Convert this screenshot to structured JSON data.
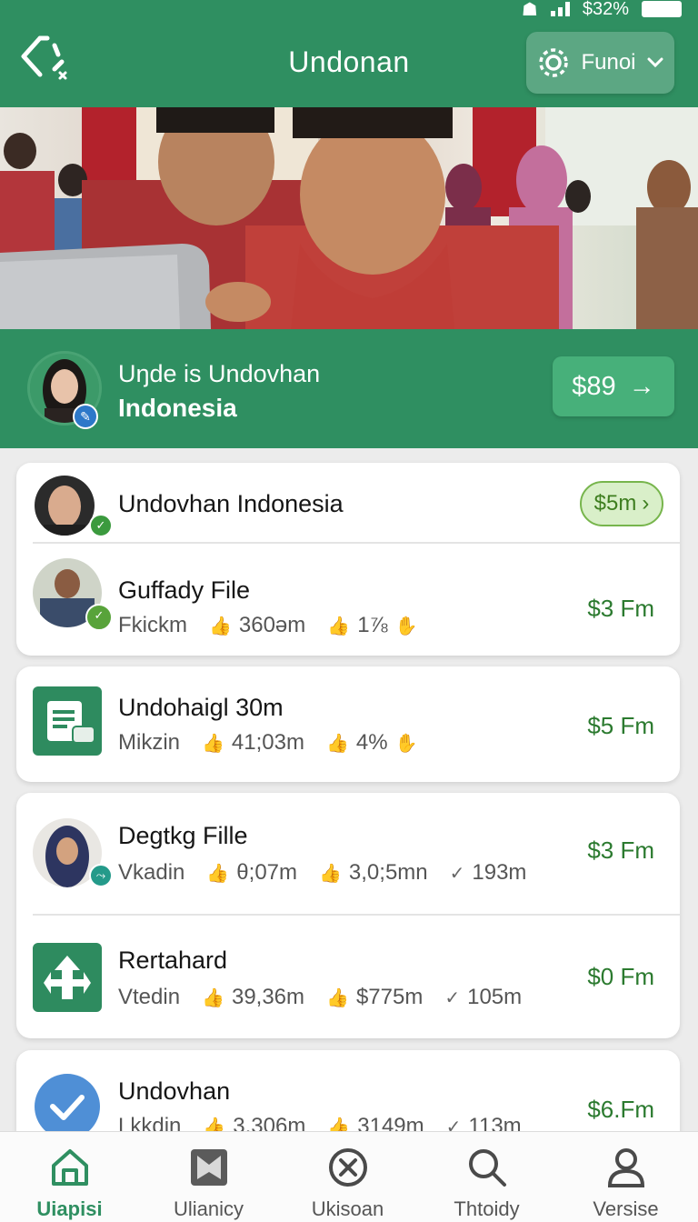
{
  "status_bar": {
    "battery": "$32%"
  },
  "header": {
    "title": "Undonan",
    "action_label": "Funoi",
    "logo_icon": "logo-icon",
    "brand_color": "#2f8f61"
  },
  "promo": {
    "line1": "Uŋde is Undovhan",
    "line2": "Indonesia",
    "price": "$89",
    "arrow": "→"
  },
  "cards": [
    {
      "rows": [
        {
          "title": "Undovhan Indonesia",
          "pill": "$5m",
          "pill_arrow": "›"
        },
        {
          "title": "Guffady File",
          "meta1": "Fkickm",
          "meta2": "360əm",
          "meta3": "1⅞",
          "price": "$3 Fm"
        }
      ]
    },
    {
      "rows": [
        {
          "title": "Undohaigl 30m",
          "meta1": "Mikzin",
          "meta2": "41;03m",
          "meta3": "4%",
          "price": "$5 Fm"
        }
      ]
    },
    {
      "rows": [
        {
          "title": "Degtkg Fille",
          "meta1": "Vkadin",
          "meta2": "θ;07m",
          "meta3": "3,0;5mn",
          "meta4": "193m",
          "price": "$3 Fm"
        },
        {
          "title": "Rertahard",
          "meta1": "Vtedin",
          "meta2": "39,36m",
          "meta3": "$775m",
          "meta4": "105m",
          "price": "$0 Fm"
        }
      ]
    },
    {
      "rows": [
        {
          "title": "Undovhan",
          "meta1": "Lkkdin",
          "meta2": "3,306m",
          "meta3": "3149m",
          "meta4": "113m",
          "price": "$6.Fm"
        }
      ]
    }
  ],
  "nav": [
    {
      "label": "Uiapisi",
      "icon": "home-icon",
      "active": true
    },
    {
      "label": "Ulianicy",
      "icon": "book-icon",
      "active": false
    },
    {
      "label": "Ukisoan",
      "icon": "close-circle-icon",
      "active": false
    },
    {
      "label": "Thtoidy",
      "icon": "search-icon",
      "active": false
    },
    {
      "label": "Versise",
      "icon": "profile-icon",
      "active": false
    }
  ]
}
